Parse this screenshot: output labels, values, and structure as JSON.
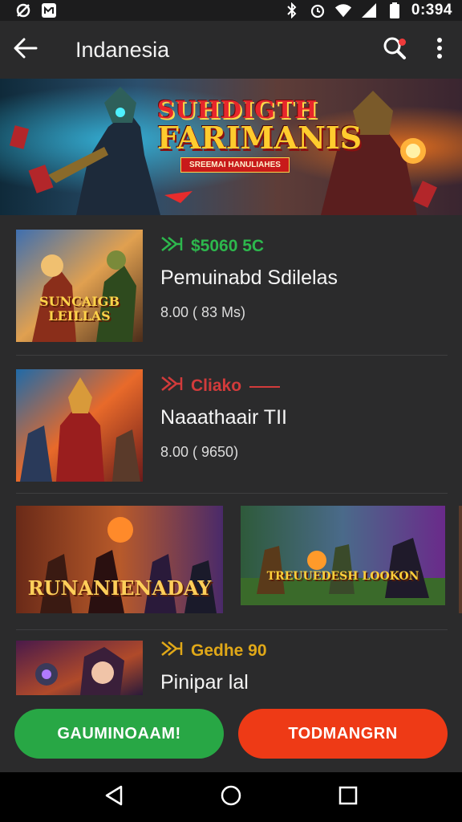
{
  "status_bar": {
    "time": "0:394",
    "left_icons": [
      "settings-icon",
      "notification-icon"
    ],
    "right_icons": [
      "bluetooth-icon",
      "alarm-icon",
      "wifi-icon",
      "signal-icon",
      "battery-icon"
    ]
  },
  "app_bar": {
    "title": "Indanesia",
    "icons": [
      "arrow-back-icon",
      "search-icon",
      "more-vert-icon"
    ]
  },
  "hero": {
    "title_line1": "SUHDIGTH",
    "title_line2": "FARIMANIS",
    "ribbon": "SREEMAI HANULIAHES"
  },
  "items": [
    {
      "thumb_text_1": "SUNCAIGB",
      "thumb_text_2": "LEILLAS",
      "tag_text": "$5060 5C",
      "tag_color": "#2db84d",
      "title": "Pemuinabd Sdilelas",
      "price": "8.00 ( 83 Ms)"
    },
    {
      "tag_text": "Cliako",
      "tag_color": "#d23b3b",
      "title": "Naaathaair TII",
      "price": "8.00 ( 9650)"
    },
    {
      "tag_text": "Gedhe 90",
      "tag_color": "#e0a818",
      "title": "Pinipar lal"
    }
  ],
  "carousel": [
    {
      "caption": "RUNANIENADAY"
    },
    {
      "caption": "TREUUEDESH LOOKON"
    }
  ],
  "buttons": {
    "primary": "GAUMINOAAM!",
    "secondary": "TODMANGRN"
  },
  "colors": {
    "primary_button": "#28a745",
    "secondary_button": "#ee3a16",
    "background": "#2b2b2c"
  }
}
